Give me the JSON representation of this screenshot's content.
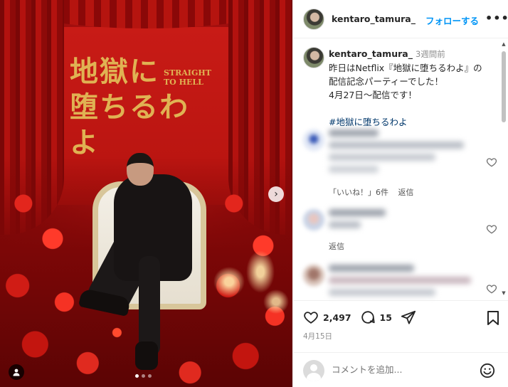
{
  "photo": {
    "title_jp_line1": "地獄に",
    "title_jp_line2": "堕ちるわよ",
    "title_en_line1": "STRAIGHT",
    "title_en_line2": "TO HELL",
    "next_arrow": "›",
    "slide_count": 3,
    "slide_active": 1
  },
  "header": {
    "username": "kentaro_tamura_",
    "follow_label": "フォローする",
    "more_label": "•••"
  },
  "caption": {
    "username": "kentaro_tamura_",
    "time": "3週間前",
    "lines": [
      "昨日はNetflix『地獄に堕ちるわよ』の",
      "配信記念パーティーでした！",
      "4月27日〜配信です！"
    ],
    "hashtag": "#地獄に堕ちるわよ"
  },
  "comments": [
    {
      "likes_label": "「いいね！」6件",
      "reply_label": "返信"
    },
    {
      "reply_label": "返信"
    },
    {}
  ],
  "actions": {
    "like_count": "2,497",
    "comment_count": "15",
    "date": "4月15日"
  },
  "add_comment": {
    "placeholder": "コメントを追加..."
  },
  "colors": {
    "accent": "#0095f6",
    "hashtag": "#00376b",
    "banner_red": "#b6130f",
    "title_gold": "#e0b253"
  },
  "icons": [
    "chevron-right-icon",
    "user-tag-icon",
    "more-icon",
    "heart-icon",
    "comment-icon",
    "share-icon",
    "bookmark-icon",
    "emoji-icon"
  ]
}
